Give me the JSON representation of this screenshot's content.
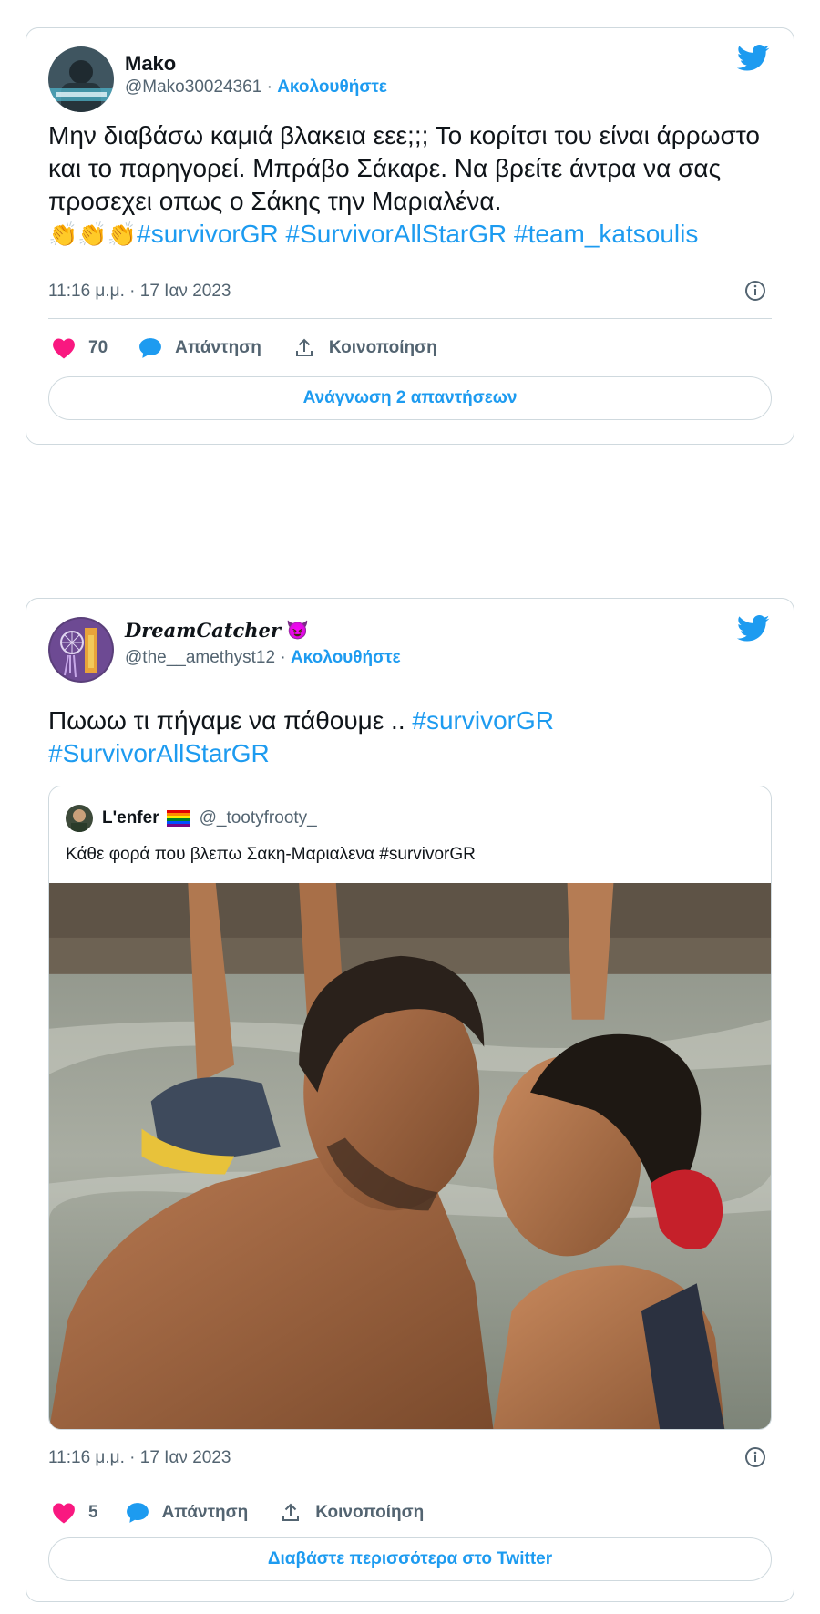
{
  "tweets": [
    {
      "name": "Mako",
      "handle": "@Mako30024361",
      "separator": "·",
      "follow": "Ακολουθήστε",
      "text_plain": "Μην διαβάσω καμιά βλακεια  εεε;;; Το κορίτσι του είναι άρρωστο και το παρηγορεί. Μπράβο Σάκαρε. Να βρείτε άντρα να σας προσεχει οπως ο Σάκης την Μαριαλένα.",
      "claps": "👏👏👏",
      "hashtags": [
        "#survivorGR",
        "#SurvivorAllStarGR",
        "#team_katsoulis"
      ],
      "time": "11:16 μ.μ. · 17 Ιαν 2023",
      "likes": "70",
      "reply": "Απάντηση",
      "share": "Κοινοποίηση",
      "pill": "Ανάγνωση 2 απαντήσεων"
    },
    {
      "name": "DreamCatcher",
      "name_emoji": "😈",
      "handle": "@the__amethyst12",
      "separator": "·",
      "follow": "Ακολουθήστε",
      "text_plain": "Πωωω τι πήγαμε να πάθουμε ..",
      "hashtags": [
        "#survivorGR",
        "#SurvivorAllStarGR"
      ],
      "quote": {
        "name": "L'enfer",
        "flag": "rainbow-flag",
        "handle": "@_tootyfrooty_",
        "text": "Κάθε φορά που βλεπω Σακη-Μαριαλενα #survivorGR"
      },
      "time": "11:16 μ.μ. · 17 Ιαν 2023",
      "likes": "5",
      "reply": "Απάντηση",
      "share": "Κοινοποίηση",
      "pill": "Διαβάστε περισσότερα στο Twitter"
    }
  ],
  "colors": {
    "accent": "#1d9bf0",
    "heart": "#f91880",
    "muted": "#536471",
    "border": "#cfd9de"
  },
  "icons": [
    "twitter-bird-icon",
    "info-icon",
    "heart-icon",
    "reply-bubble-icon",
    "share-icon"
  ]
}
